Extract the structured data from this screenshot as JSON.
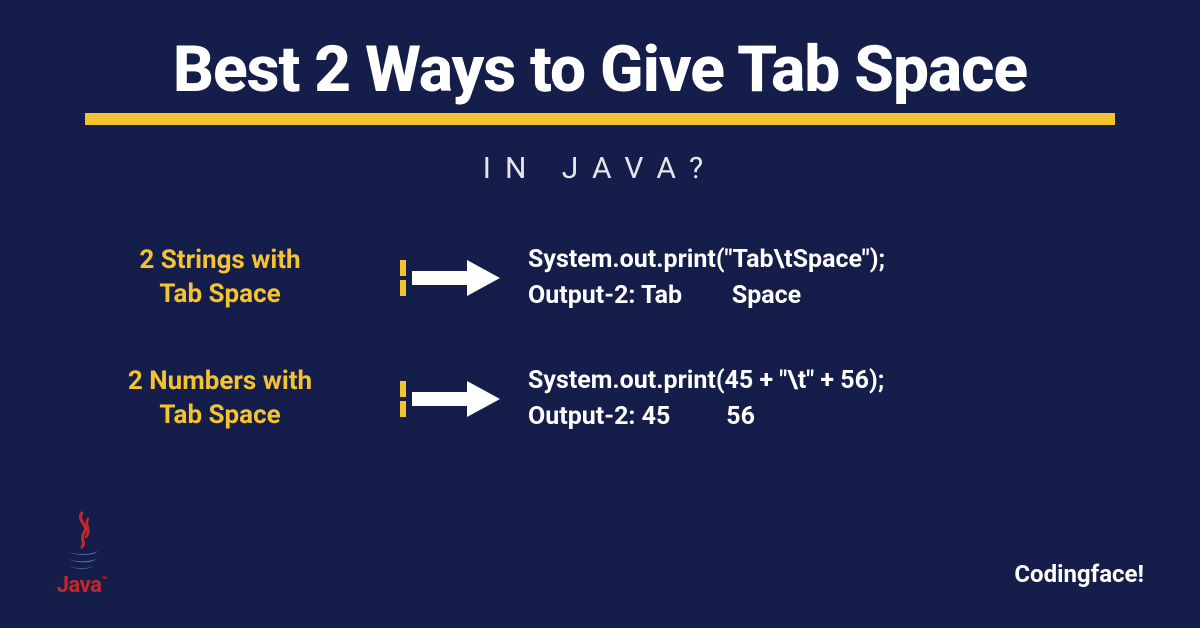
{
  "header": {
    "title": "Best 2 Ways to Give Tab Space",
    "subtitle": "IN JAVA?"
  },
  "rows": [
    {
      "label_line1": "2 Strings with",
      "label_line2": "Tab Space",
      "code_line1": "System.out.print(\"Tab\\tSpace\");",
      "code_line2": "Output-2: Tab        Space"
    },
    {
      "label_line1": "2 Numbers with",
      "label_line2": "Tab Space",
      "code_line1": "System.out.print(45 + \"\\t\" + 56);",
      "code_line2": "Output-2: 45         56"
    }
  ],
  "logo": {
    "text": "Java",
    "tm": "™"
  },
  "brand": "Codingface!"
}
